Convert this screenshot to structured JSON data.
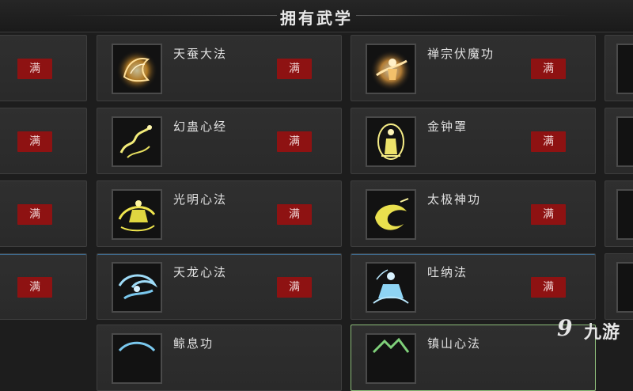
{
  "title": "拥有武学",
  "badge_label": "满",
  "rows": [
    {
      "mid": {
        "name": "天蚕大法",
        "icon": "golden-silkworm-icon",
        "glow": "#f0b24a"
      },
      "right": {
        "name": "禅宗伏魔功",
        "icon": "golden-monk-icon",
        "glow": "#f2b35a"
      }
    },
    {
      "mid": {
        "name": "幻蛊心经",
        "icon": "yellow-dragon-icon",
        "glow": "#e8e060"
      },
      "right": {
        "name": "金钟罩",
        "icon": "golden-bell-icon",
        "glow": "#f0e070"
      }
    },
    {
      "mid": {
        "name": "光明心法",
        "icon": "yellow-meditation-icon",
        "glow": "#e9e34e"
      },
      "right": {
        "name": "太极神功",
        "icon": "taiji-swirl-icon",
        "glow": "#efe65a"
      }
    },
    {
      "mid": {
        "name": "天龙心法",
        "icon": "blue-dragon-icon",
        "glow": "#7ac8ee"
      },
      "right": {
        "name": "吐纳法",
        "icon": "blue-meditation-icon",
        "glow": "#8ed4f4"
      }
    },
    {
      "mid": {
        "name": "鲸息功",
        "icon": "blue-whale-icon",
        "glow": "#7ac8ee"
      },
      "right": {
        "name": "镇山心法",
        "icon": "green-mountain-icon",
        "glow": "#7fd07a"
      }
    }
  ],
  "watermark": {
    "text": "九游",
    "symbol": "9"
  }
}
